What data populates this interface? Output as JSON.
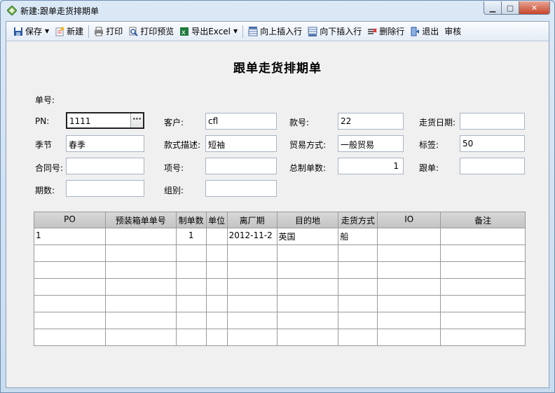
{
  "window": {
    "title": "新建:跟单走货排期单"
  },
  "toolbar": {
    "save": "保存",
    "new": "新建",
    "print": "打印",
    "print_preview": "打印预览",
    "export_excel": "导出Excel",
    "insert_above": "向上插入行",
    "insert_below": "向下插入行",
    "delete_row": "删除行",
    "exit": "退出",
    "review": "审核"
  },
  "form": {
    "title": "跟单走货排期单",
    "order_no_label": "单号:",
    "pn_label": "PN:",
    "pn_value": "1111",
    "customer_label": "客户:",
    "customer_value": "cfl",
    "style_no_label": "款号:",
    "style_no_value": "22",
    "ship_date_label": "走货日期:",
    "ship_date_value": "",
    "season_label": "季节",
    "season_value": "春季",
    "style_desc_label": "款式描述:",
    "style_desc_value": "短袖",
    "trade_mode_label": "贸易方式:",
    "trade_mode_value": "一般贸易",
    "tag_label": "标签:",
    "tag_value": "50",
    "contract_label": "合同号:",
    "contract_value": "",
    "item_no_label": "项号:",
    "item_no_value": "",
    "total_qty_label": "总制单数:",
    "total_qty_value": "1",
    "follower_label": "跟单:",
    "follower_value": "",
    "period_label": "期数:",
    "period_value": "",
    "group_label": "组别:",
    "group_value": ""
  },
  "grid": {
    "headers": [
      "PO",
      "预装箱单单号",
      "制单数",
      "单位",
      "离厂期",
      "目的地",
      "走货方式",
      "IO",
      "备注"
    ],
    "rows": [
      [
        "1",
        "",
        "1",
        "",
        "2012-11-2",
        "英国",
        "船",
        "",
        ""
      ],
      [
        "",
        "",
        "",
        "",
        "",
        "",
        "",
        "",
        ""
      ],
      [
        "",
        "",
        "",
        "",
        "",
        "",
        "",
        "",
        ""
      ],
      [
        "",
        "",
        "",
        "",
        "",
        "",
        "",
        "",
        ""
      ],
      [
        "",
        "",
        "",
        "",
        "",
        "",
        "",
        "",
        ""
      ],
      [
        "",
        "",
        "",
        "",
        "",
        "",
        "",
        "",
        ""
      ],
      [
        "",
        "",
        "",
        "",
        "",
        "",
        "",
        "",
        ""
      ]
    ]
  }
}
